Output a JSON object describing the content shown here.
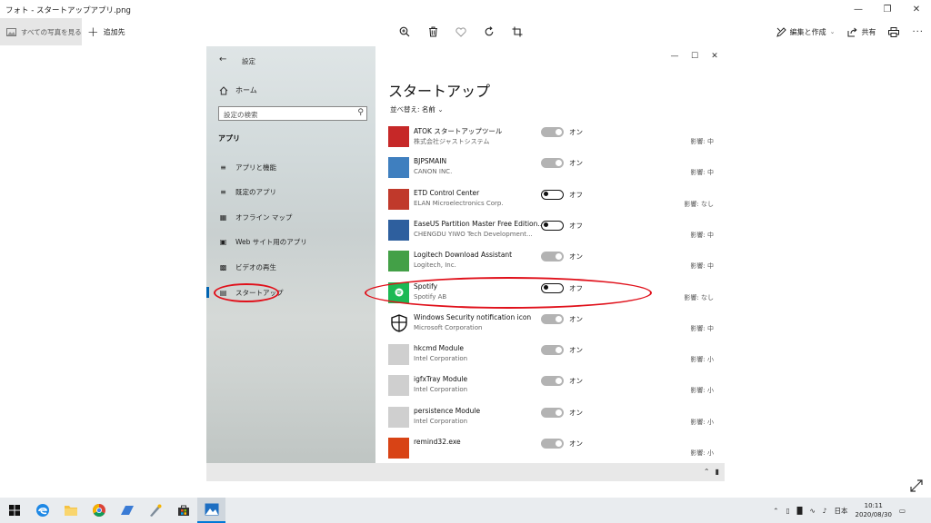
{
  "photos_app": {
    "title": "フォト - スタートアップアプリ.png",
    "all_photos_label": "すべての写真を見る",
    "add_to_label": "追加先",
    "edit_create_label": "編集と作成",
    "share_label": "共有",
    "icons": [
      "zoom-icon",
      "delete-icon",
      "heart-icon",
      "rotate-icon",
      "crop-icon",
      "print-icon",
      "expand-icon"
    ]
  },
  "settings": {
    "window_title": "設定",
    "home_label": "ホーム",
    "search_placeholder": "設定の検索",
    "section_label": "アプリ",
    "nav_items": [
      {
        "label": "アプリと機能",
        "icon": "list-icon"
      },
      {
        "label": "既定のアプリ",
        "icon": "default-apps-icon"
      },
      {
        "label": "オフライン マップ",
        "icon": "map-icon"
      },
      {
        "label": "Web サイト用のアプリ",
        "icon": "web-apps-icon"
      },
      {
        "label": "ビデオの再生",
        "icon": "video-icon"
      },
      {
        "label": "スタートアップ",
        "icon": "startup-icon",
        "active": true
      }
    ],
    "heading": "スタートアップ",
    "sort_label": "並べ替え:",
    "sort_value": "名前",
    "apps": [
      {
        "name": "ATOK スタートアップツール",
        "publisher": "株式会社ジャストシステム",
        "state": "on",
        "state_label": "オン",
        "impact": "影響: 中",
        "icon_color": "#c62828"
      },
      {
        "name": "BJPSMAIN",
        "publisher": "CANON INC.",
        "state": "on",
        "state_label": "オン",
        "impact": "影響: 中",
        "icon_color": "#3f7fbf"
      },
      {
        "name": "ETD Control Center",
        "publisher": "ELAN Microelectronics Corp.",
        "state": "off",
        "state_label": "オフ",
        "impact": "影響: なし",
        "icon_color": "#c0392b"
      },
      {
        "name": "EaseUS Partition Master Free Edition...",
        "publisher": "CHENGDU YIWO Tech Development...",
        "state": "off",
        "state_label": "オフ",
        "impact": "影響: 中",
        "icon_color": "#2e5f9e"
      },
      {
        "name": "Logitech Download Assistant",
        "publisher": "Logitech, Inc.",
        "state": "on",
        "state_label": "オン",
        "impact": "影響: 中",
        "icon_color": "#43a047"
      },
      {
        "name": "Spotify",
        "publisher": "Spotify AB",
        "state": "off",
        "state_label": "オフ",
        "impact": "影響: なし",
        "icon_color": "#1db954"
      },
      {
        "name": "Windows Security notification icon",
        "publisher": "Microsoft Corporation",
        "state": "on",
        "state_label": "オン",
        "impact": "影響: 中",
        "icon_color": "#ffffff"
      },
      {
        "name": "hkcmd Module",
        "publisher": "Intel Corporation",
        "state": "on",
        "state_label": "オン",
        "impact": "影響: 小",
        "icon_color": "#cfcfcf"
      },
      {
        "name": "igfxTray Module",
        "publisher": "Intel Corporation",
        "state": "on",
        "state_label": "オン",
        "impact": "影響: 小",
        "icon_color": "#cfcfcf"
      },
      {
        "name": "persistence Module",
        "publisher": "Intel Corporation",
        "state": "on",
        "state_label": "オン",
        "impact": "影響: 小",
        "icon_color": "#cfcfcf"
      },
      {
        "name": "remind32.exe",
        "publisher": "",
        "state": "on",
        "state_label": "オン",
        "impact": "影響: 小",
        "icon_color": "#d84315"
      }
    ]
  },
  "taskbar": {
    "language": "日本",
    "time": "10:11",
    "date": "2020/08/30"
  },
  "colors": {
    "annotation_red": "#e0101a",
    "accent_blue": "#0078d7"
  }
}
